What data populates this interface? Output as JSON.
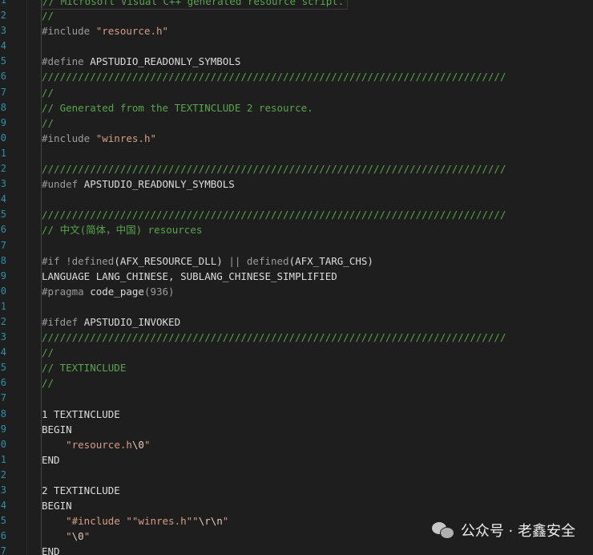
{
  "line_numbers": [
    "1",
    "2",
    "3",
    "4",
    "5",
    "6",
    "7",
    "8",
    "9",
    "0",
    "1",
    "2",
    "3",
    "4",
    "5",
    "6",
    "7",
    "8",
    "9",
    "0",
    "1",
    "2",
    "3",
    "4",
    "5",
    "6",
    "7",
    "8",
    "9",
    "0",
    "1",
    "2",
    "3",
    "4",
    "5",
    "6",
    "7"
  ],
  "code": {
    "l01": "// Microsoft Visual C++ generated resource script.",
    "l02": "//",
    "l03_a": "#include ",
    "l03_b": "\"resource.h\"",
    "l05_a": "#define ",
    "l05_b": "APSTUDIO_READONLY_SYMBOLS",
    "l06": "/////////////////////////////////////////////////////////////////////////////",
    "l07": "//",
    "l08": "// Generated from the TEXTINCLUDE 2 resource.",
    "l09": "//",
    "l10_a": "#include ",
    "l10_b": "\"winres.h\"",
    "l12": "/////////////////////////////////////////////////////////////////////////////",
    "l13_a": "#undef ",
    "l13_b": "APSTUDIO_READONLY_SYMBOLS",
    "l15": "/////////////////////////////////////////////////////////////////////////////",
    "l16": "// 中文(简体，中国) resources",
    "l18_a": "#if !defined",
    "l18_b": "(AFX_RESOURCE_DLL) ",
    "l18_c": "|| defined",
    "l18_d": "(AFX_TARG_CHS)",
    "l19": "LANGUAGE LANG_CHINESE, SUBLANG_CHINESE_SIMPLIFIED",
    "l20_a": "#pragma ",
    "l20_b": "code_page",
    "l20_c": "(936)",
    "l22_a": "#ifdef ",
    "l22_b": "APSTUDIO_INVOKED",
    "l23": "/////////////////////////////////////////////////////////////////////////////",
    "l24": "//",
    "l25": "// TEXTINCLUDE",
    "l26": "//",
    "l28": "1 TEXTINCLUDE",
    "l29": "BEGIN",
    "l30_a": "    ",
    "l30_b": "\"resource.h",
    "l30_c": "\\0",
    "l30_d": "\"",
    "l31": "END",
    "l33": "2 TEXTINCLUDE",
    "l34": "BEGIN",
    "l35_a": "    ",
    "l35_b": "\"#include \"\"winres.h\"\"",
    "l35_c": "\\r\\n",
    "l35_d": "\"",
    "l36_a": "    ",
    "l36_b": "\"",
    "l36_c": "\\0",
    "l36_d": "\"",
    "l37": "END"
  },
  "watermark": {
    "text": "公众号 · 老鑫安全",
    "icon": "wechat-icon"
  }
}
